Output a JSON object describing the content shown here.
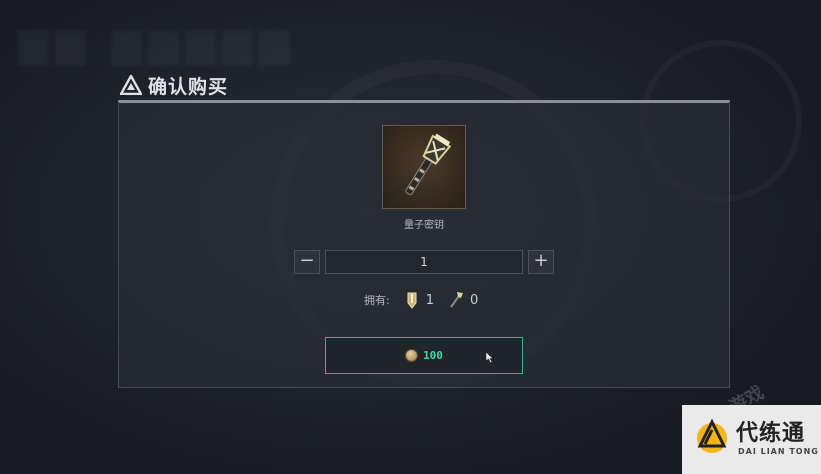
{
  "dialog": {
    "title": "确认购买",
    "item": {
      "name": "量子密钥",
      "icon": "quantum-key-icon"
    },
    "quantity": {
      "minus_label": "−",
      "value": "1",
      "plus_label": "+"
    },
    "owned": {
      "label": "拥有:",
      "items": [
        {
          "icon": "bullet-icon",
          "count": "1"
        },
        {
          "icon": "key-icon",
          "count": "0"
        }
      ]
    },
    "purchase": {
      "icon": "coin-icon",
      "price": "100"
    }
  },
  "background": {
    "blur_text": "..."
  },
  "watermark": {
    "brand": "代练通",
    "sub": "DAI LIAN TONG",
    "ghost": "游戏"
  },
  "colors": {
    "accent": "#3fae8f",
    "price": "#3fd6a3",
    "panel_border_top": "#8a8f98"
  }
}
